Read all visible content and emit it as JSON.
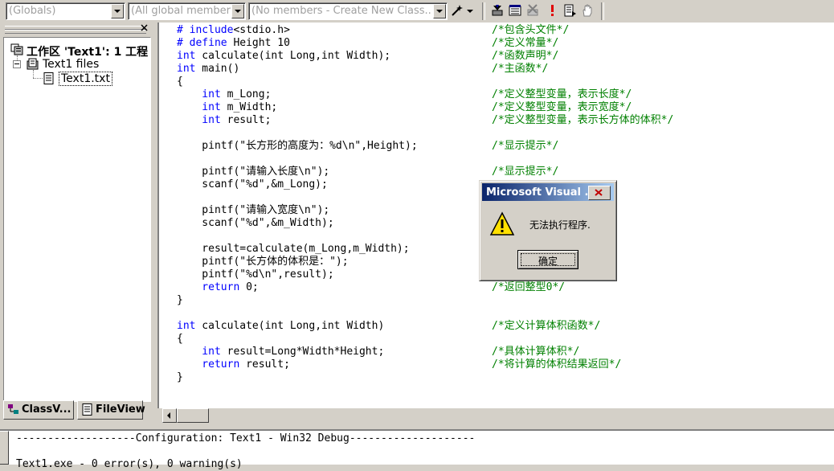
{
  "toolbar": {
    "combo_globals": "(Globals)",
    "combo_members": "(All global members",
    "combo_class_members": "(No members - Create New Class..."
  },
  "workspace": {
    "root_label": "工作区 'Text1': 1 工程",
    "project_label": "Text1 files",
    "file_label": "Text1.txt"
  },
  "tabs": {
    "classview": "ClassV...",
    "fileview": "FileView"
  },
  "code": [
    {
      "kw": "# include",
      "rest": "<stdio.h>",
      "comment": "/*包含头文件*/"
    },
    {
      "kw": "# define",
      "rest": " Height 10",
      "comment": "/*定义常量*/"
    },
    {
      "kw": "int",
      "rest": " calculate(int Long,int Width);",
      "comment": "/*函数声明*/"
    },
    {
      "kw": "int",
      "rest": " main()",
      "comment": "/*主函数*/"
    },
    {
      "kw": "",
      "rest": "{",
      "comment": ""
    },
    {
      "kw": "    int",
      "rest": " m_Long;",
      "comment": "/*定义整型变量，表示长度*/"
    },
    {
      "kw": "    int",
      "rest": " m_Width;",
      "comment": "/*定义整型变量，表示宽度*/"
    },
    {
      "kw": "    int",
      "rest": " result;",
      "comment": "/*定义整型变量，表示长方体的体积*/"
    },
    {
      "kw": "",
      "rest": "",
      "comment": ""
    },
    {
      "kw": "",
      "rest": "    pintf(\"长方形的高度为：%d\\n\",Height);",
      "comment": "/*显示提示*/"
    },
    {
      "kw": "",
      "rest": "",
      "comment": ""
    },
    {
      "kw": "",
      "rest": "    pintf(\"请输入长度\\n\");",
      "comment": "/*显示提示*/"
    },
    {
      "kw": "",
      "rest": "    scanf(\"%d\",&m_Long);",
      "comment": ""
    },
    {
      "kw": "",
      "rest": "",
      "comment": ""
    },
    {
      "kw": "",
      "rest": "    pintf(\"请输入宽度\\n\");",
      "comment": ""
    },
    {
      "kw": "",
      "rest": "    scanf(\"%d\",&m_Width);",
      "comment": ""
    },
    {
      "kw": "",
      "rest": "",
      "comment": ""
    },
    {
      "kw": "",
      "rest": "    result=calculate(m_Long,m_Width);",
      "comment": ""
    },
    {
      "kw": "",
      "rest": "    pintf(\"长方体的体积是：\");",
      "comment": ""
    },
    {
      "kw": "",
      "rest": "    pintf(\"%d\\n\",result);",
      "comment": ""
    },
    {
      "kw": "    return",
      "rest": " 0;",
      "comment": "/*返回整型0*/"
    },
    {
      "kw": "",
      "rest": "}",
      "comment": ""
    },
    {
      "kw": "",
      "rest": "",
      "comment": ""
    },
    {
      "kw": "int",
      "rest": " calculate(int Long,int Width)",
      "comment": "/*定义计算体积函数*/"
    },
    {
      "kw": "",
      "rest": "{",
      "comment": ""
    },
    {
      "kw": "    int",
      "rest": " result=Long*Width*Height;",
      "comment": "/*具体计算体积*/"
    },
    {
      "kw": "    return",
      "rest": " result;",
      "comment": "/*将计算的体积结果返回*/"
    },
    {
      "kw": "",
      "rest": "}",
      "comment": ""
    }
  ],
  "output": {
    "line1": "-------------------Configuration: Text1 - Win32 Debug--------------------",
    "line2": "Text1.exe - 0 error(s), 0 warning(s)"
  },
  "dialog": {
    "title": "Microsoft Visual ...",
    "message": "无法执行程序.",
    "ok_label": "确定"
  }
}
